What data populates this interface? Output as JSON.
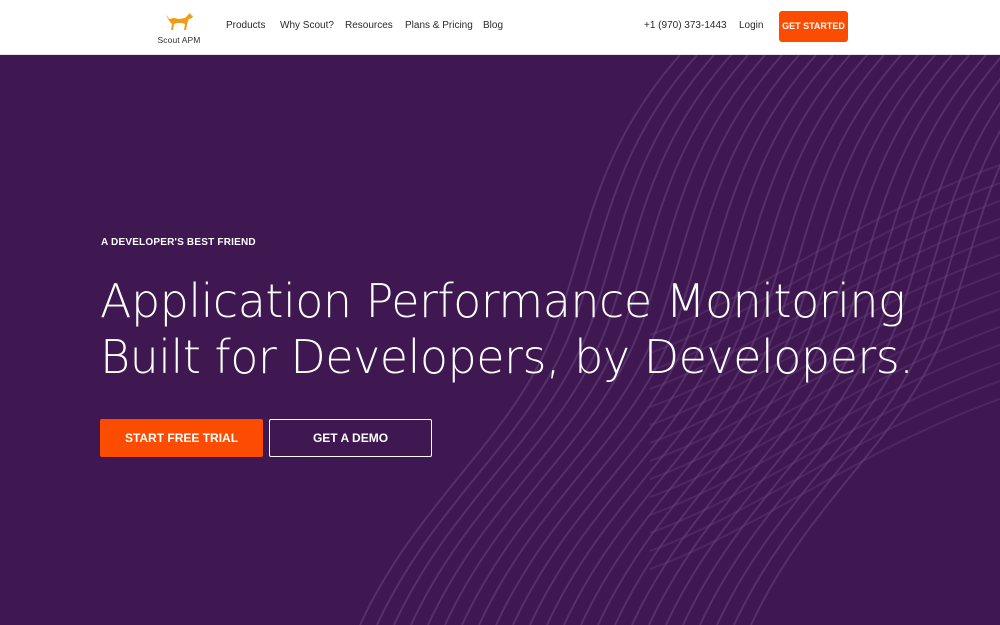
{
  "colors": {
    "brand_orange": "#fc4c02",
    "hero_purple": "#3f1751",
    "wave_line": "#6a4680"
  },
  "nav": {
    "logo_text": "Scout APM",
    "logo_icon": "dog-icon",
    "links": [
      "Products",
      "Why Scout?",
      "Resources",
      "Plans & Pricing",
      "Blog"
    ],
    "phone": "+1 (970) 373-1443",
    "login": "Login",
    "cta": "GET STARTED"
  },
  "hero": {
    "eyebrow": "A DEVELOPER'S BEST FRIEND",
    "headline_line1": "Application Performance Monitoring",
    "headline_line2": "Built for Developers, by Developers.",
    "primary_button": "START FREE TRIAL",
    "secondary_button": "GET A DEMO"
  }
}
